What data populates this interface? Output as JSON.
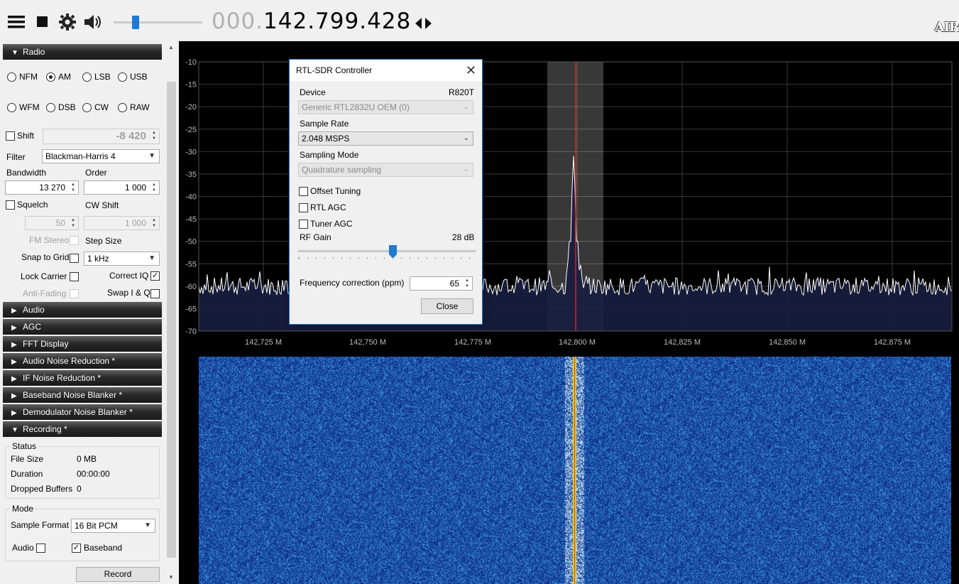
{
  "toolbar": {
    "frequency_dim": "000.",
    "frequency_main": "142.799.428",
    "logo": "AIR"
  },
  "radio": {
    "header": "Radio",
    "modes": [
      "NFM",
      "AM",
      "LSB",
      "USB",
      "WFM",
      "DSB",
      "CW",
      "RAW"
    ],
    "selected_mode": "AM",
    "shift_label": "Shift",
    "shift_value": "-8 420",
    "filter_label": "Filter",
    "filter_value": "Blackman-Harris 4",
    "bandwidth_label": "Bandwidth",
    "bandwidth_value": "13 270",
    "order_label": "Order",
    "order_value": "1 000",
    "squelch_label": "Squelch",
    "squelch_value": "50",
    "cw_shift_label": "CW Shift",
    "cw_shift_value": "1 000",
    "fm_stereo_label": "FM Stereo",
    "step_size_label": "Step Size",
    "snap_label": "Snap to Grid",
    "step_size_value": "1 kHz",
    "lock_carrier_label": "Lock Carrier",
    "correct_iq_label": "Correct IQ",
    "anti_fading_label": "Anti-Fading",
    "swap_iq_label": "Swap I & Q"
  },
  "panels": [
    "Audio",
    "AGC",
    "FFT Display",
    "Audio Noise Reduction *",
    "IF Noise Reduction *",
    "Baseband Noise Blanker *",
    "Demodulator Noise Blanker *"
  ],
  "recording": {
    "header": "Recording *",
    "status_label": "Status",
    "file_size_label": "File Size",
    "file_size_value": "0 MB",
    "duration_label": "Duration",
    "duration_value": "00:00:00",
    "dropped_label": "Dropped Buffers",
    "dropped_value": "0",
    "mode_label": "Mode",
    "sample_format_label": "Sample Format",
    "sample_format_value": "16 Bit PCM",
    "audio_label": "Audio",
    "baseband_label": "Baseband",
    "record_button": "Record"
  },
  "chart_data": {
    "type": "line",
    "ylim": [
      -70,
      -10
    ],
    "yticks": [
      "-10",
      "-15",
      "-20",
      "-25",
      "-30",
      "-35",
      "-40",
      "-45",
      "-50",
      "-55",
      "-60",
      "-65",
      "-70"
    ],
    "xticks": [
      "142,725 M",
      "142,750 M",
      "142,775 M",
      "142,800 M",
      "142,825 M",
      "142,850 M",
      "142,875 M"
    ],
    "noise_floor": -60,
    "peak": {
      "x": "142,800 M",
      "y": -31
    }
  },
  "dialog": {
    "title": "RTL-SDR Controller",
    "device_label": "Device",
    "device_model": "R820T",
    "device_value": "Generic RTL2832U OEM (0)",
    "sample_rate_label": "Sample Rate",
    "sample_rate_value": "2.048 MSPS",
    "sampling_mode_label": "Sampling Mode",
    "sampling_mode_value": "Quadrature sampling",
    "offset_tuning_label": "Offset Tuning",
    "rtl_agc_label": "RTL AGC",
    "tuner_agc_label": "Tuner AGC",
    "rf_gain_label": "RF Gain",
    "rf_gain_value": "28 dB",
    "freq_corr_label": "Frequency correction (ppm)",
    "freq_corr_value": "65",
    "close_button": "Close"
  }
}
